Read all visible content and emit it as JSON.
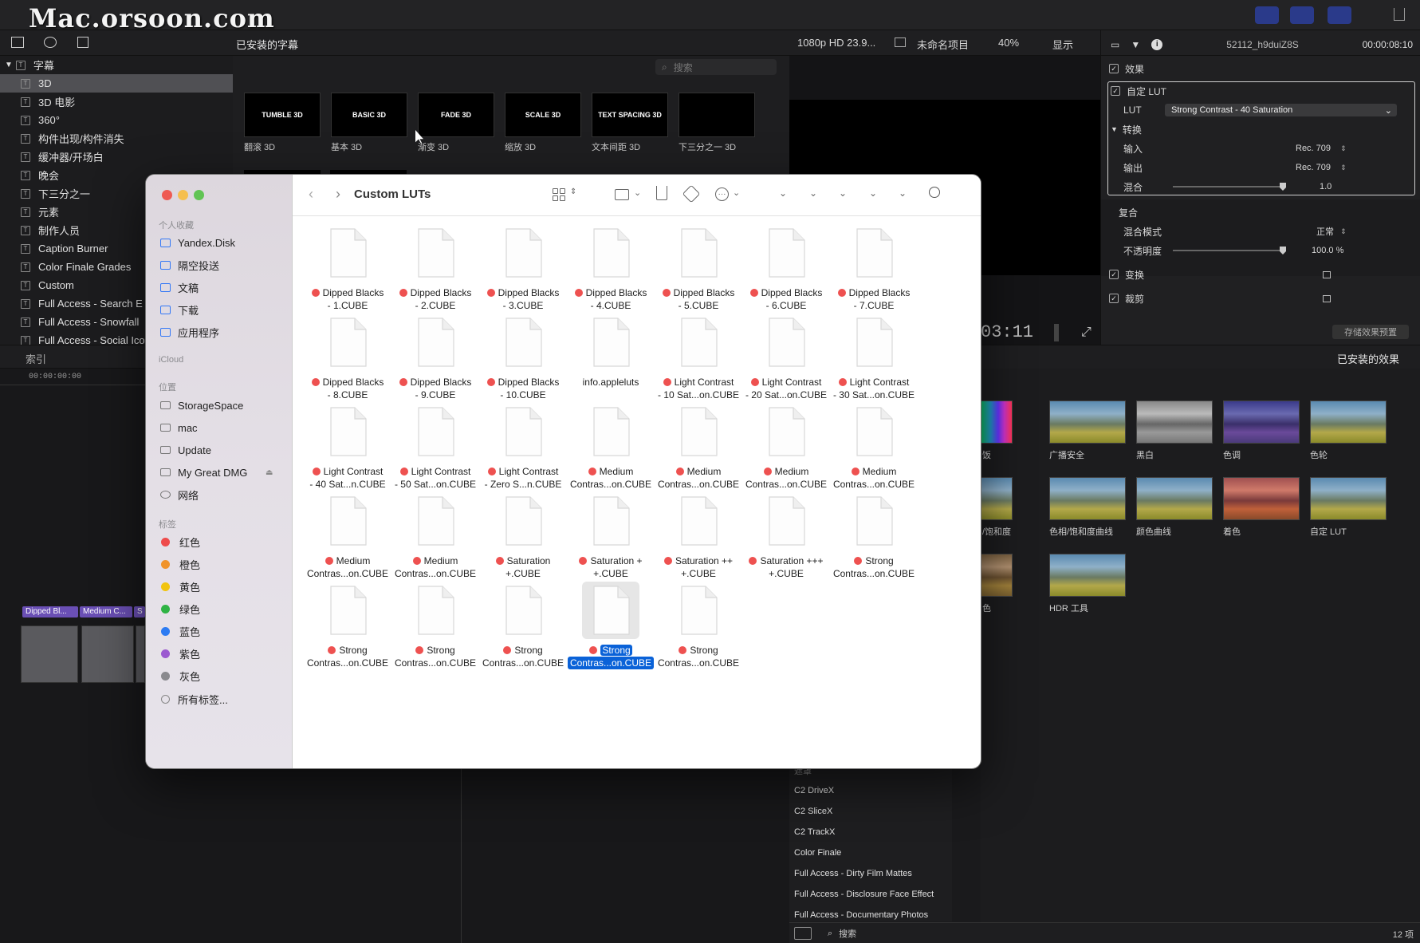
{
  "watermark": "Mac.orsoon.com",
  "library": {
    "header_label": "已安装的字幕",
    "root": "字幕",
    "items": [
      "3D",
      "3D 电影",
      "360°",
      "构件出现/构件消失",
      "缓冲器/开场白",
      "晚会",
      "下三分之一",
      "元素",
      "制作人员",
      "Caption Burner",
      "Color Finale Grades",
      "Custom",
      "Full Access - Search E",
      "Full Access - Snowfall",
      "Full Access - Social Ico"
    ],
    "search_placeholder": "搜索",
    "title_thumbs": [
      {
        "thumb": "TUMBLE 3D",
        "label": "翻滚 3D"
      },
      {
        "thumb": "BASIC 3D",
        "label": "基本 3D"
      },
      {
        "thumb": "FADE 3D",
        "label": "渐变 3D"
      },
      {
        "thumb": "SCALE 3D",
        "label": "缩放 3D"
      },
      {
        "thumb": "TEXT SPACING 3D",
        "label": "文本间距 3D"
      },
      {
        "thumb": "",
        "label": "下三分之一 3D"
      }
    ]
  },
  "viewer": {
    "format": "1080p HD 23.9...",
    "project": "未命名项目",
    "zoom": "40%",
    "display": "显示",
    "timecode": "03:11"
  },
  "inspector": {
    "clip_name": "52112_h9duiZ8S",
    "duration": "00:00:08:10",
    "effects": "效果",
    "custom_lut": "自定 LUT",
    "lut_label": "LUT",
    "lut_value": "Strong Contrast - 40 Saturation",
    "convert": "转换",
    "input_label": "输入",
    "input_value": "Rec. 709",
    "output_label": "输出",
    "output_value": "Rec. 709",
    "mix_label": "混合",
    "mix_value": "1.0",
    "composite": "复合",
    "blend_label": "混合模式",
    "blend_value": "正常",
    "opacity_label": "不透明度",
    "opacity_value": "100.0 %",
    "transform": "变换",
    "crop": "裁剪",
    "save_preset": "存储效果预置"
  },
  "timeline": {
    "index": "索引",
    "tc": "00:00:00:00",
    "clips": [
      "Dipped Bl...",
      "Medium C...",
      "S"
    ]
  },
  "effects": {
    "header": "已安装的效果",
    "thumbs": [
      {
        "label": "饭",
        "color": "spectrum"
      },
      {
        "label": "广播安全",
        "color": "natural"
      },
      {
        "label": "黑白",
        "color": "bw"
      },
      {
        "label": "色调",
        "color": "purple"
      },
      {
        "label": "色轮",
        "color": "natural"
      },
      {
        "label": "/饱和度",
        "color": "natural"
      },
      {
        "label": "色相/饱和度曲线",
        "color": "natural"
      },
      {
        "label": "颜色曲线",
        "color": "natural"
      },
      {
        "label": "着色",
        "color": "red"
      },
      {
        "label": "自定 LUT",
        "color": "natural"
      },
      {
        "label": "色",
        "color": "sepia"
      },
      {
        "label": "HDR 工具",
        "color": "natural"
      }
    ],
    "list_partial": "遮罩",
    "list": [
      "C2 DriveX",
      "C2 SliceX",
      "C2 TrackX",
      "Color Finale",
      "Full Access - Dirty Film Mattes",
      "Full Access - Disclosure Face Effect",
      "Full Access - Documentary Photos"
    ],
    "footer_search": "搜索",
    "count": "12 项"
  },
  "finder": {
    "title": "Custom LUTs",
    "favorites_head": "个人收藏",
    "favorites": [
      "Yandex.Disk",
      "隔空投送",
      "文稿",
      "下载",
      "应用程序"
    ],
    "icloud_head": "iCloud",
    "locations_head": "位置",
    "locations": [
      "StorageSpace",
      "mac",
      "Update",
      "My Great DMG",
      "网络"
    ],
    "tags_head": "标签",
    "tags": [
      {
        "name": "红色",
        "color": "#ee4b4b"
      },
      {
        "name": "橙色",
        "color": "#f0932b"
      },
      {
        "name": "黄色",
        "color": "#f1c40f"
      },
      {
        "name": "绿色",
        "color": "#2fb344"
      },
      {
        "name": "蓝色",
        "color": "#2d7bf2"
      },
      {
        "name": "紫色",
        "color": "#9b59d0"
      },
      {
        "name": "灰色",
        "color": "#8a8a8e"
      }
    ],
    "all_tags": "所有标签...",
    "files": [
      {
        "l1": "Dipped Blacks",
        "l2": "- 1.CUBE",
        "tag": true
      },
      {
        "l1": "Dipped Blacks",
        "l2": "- 2.CUBE",
        "tag": true
      },
      {
        "l1": "Dipped Blacks",
        "l2": "- 3.CUBE",
        "tag": true
      },
      {
        "l1": "Dipped Blacks",
        "l2": "- 4.CUBE",
        "tag": true
      },
      {
        "l1": "Dipped Blacks",
        "l2": "- 5.CUBE",
        "tag": true
      },
      {
        "l1": "Dipped Blacks",
        "l2": "- 6.CUBE",
        "tag": true
      },
      {
        "l1": "Dipped Blacks",
        "l2": "- 7.CUBE",
        "tag": true
      },
      {
        "l1": "Dipped Blacks",
        "l2": "- 8.CUBE",
        "tag": true
      },
      {
        "l1": "Dipped Blacks",
        "l2": "- 9.CUBE",
        "tag": true
      },
      {
        "l1": "Dipped Blacks",
        "l2": "- 10.CUBE",
        "tag": true
      },
      {
        "l1": "info.appleluts",
        "l2": "",
        "tag": false
      },
      {
        "l1": "Light Contrast",
        "l2": "- 10 Sat...on.CUBE",
        "tag": true
      },
      {
        "l1": "Light Contrast",
        "l2": "- 20 Sat...on.CUBE",
        "tag": true
      },
      {
        "l1": "Light Contrast",
        "l2": "- 30 Sat...on.CUBE",
        "tag": true
      },
      {
        "l1": "Light Contrast",
        "l2": "- 40 Sat...n.CUBE",
        "tag": true
      },
      {
        "l1": "Light Contrast",
        "l2": "- 50 Sat...on.CUBE",
        "tag": true
      },
      {
        "l1": "Light Contrast",
        "l2": "- Zero S...n.CUBE",
        "tag": true
      },
      {
        "l1": "Medium",
        "l2": "Contras...on.CUBE",
        "tag": true
      },
      {
        "l1": "Medium",
        "l2": "Contras...on.CUBE",
        "tag": true
      },
      {
        "l1": "Medium",
        "l2": "Contras...on.CUBE",
        "tag": true
      },
      {
        "l1": "Medium",
        "l2": "Contras...on.CUBE",
        "tag": true
      },
      {
        "l1": "Medium",
        "l2": "Contras...on.CUBE",
        "tag": true
      },
      {
        "l1": "Medium",
        "l2": "Contras...on.CUBE",
        "tag": true
      },
      {
        "l1": "Saturation",
        "l2": "+.CUBE",
        "tag": true
      },
      {
        "l1": "Saturation +",
        "l2": "+.CUBE",
        "tag": true
      },
      {
        "l1": "Saturation ++",
        "l2": "+.CUBE",
        "tag": true
      },
      {
        "l1": "Saturation +++",
        "l2": "+.CUBE",
        "tag": true
      },
      {
        "l1": "Strong",
        "l2": "Contras...on.CUBE",
        "tag": true
      },
      {
        "l1": "Strong",
        "l2": "Contras...on.CUBE",
        "tag": true
      },
      {
        "l1": "Strong",
        "l2": "Contras...on.CUBE",
        "tag": true
      },
      {
        "l1": "Strong",
        "l2": "Contras...on.CUBE",
        "tag": true
      },
      {
        "l1": "Strong",
        "l2": "Contras...on.CUBE",
        "tag": true,
        "selected": true
      },
      {
        "l1": "Strong",
        "l2": "Contras...on.CUBE",
        "tag": true
      }
    ]
  }
}
